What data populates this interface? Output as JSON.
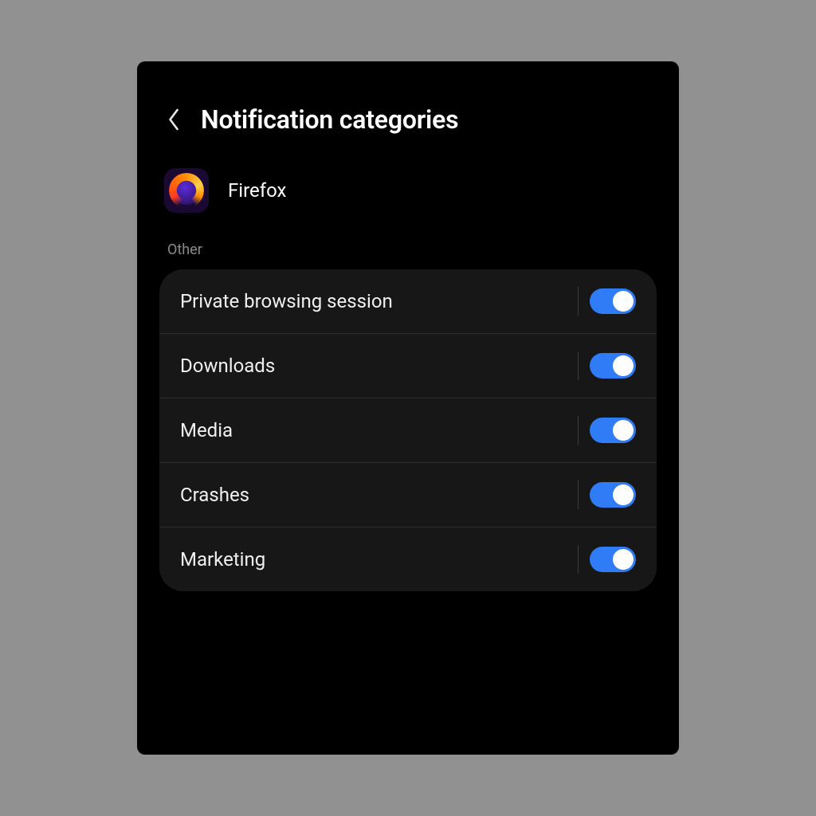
{
  "header": {
    "title": "Notification categories"
  },
  "app": {
    "name": "Firefox"
  },
  "section": {
    "label": "Other"
  },
  "categories": [
    {
      "label": "Private browsing session",
      "enabled": true
    },
    {
      "label": "Downloads",
      "enabled": true
    },
    {
      "label": "Media",
      "enabled": true
    },
    {
      "label": "Crashes",
      "enabled": true
    },
    {
      "label": "Marketing",
      "enabled": true
    }
  ],
  "colors": {
    "accent": "#2f7cf6",
    "card": "#171717",
    "bg": "#000000"
  }
}
